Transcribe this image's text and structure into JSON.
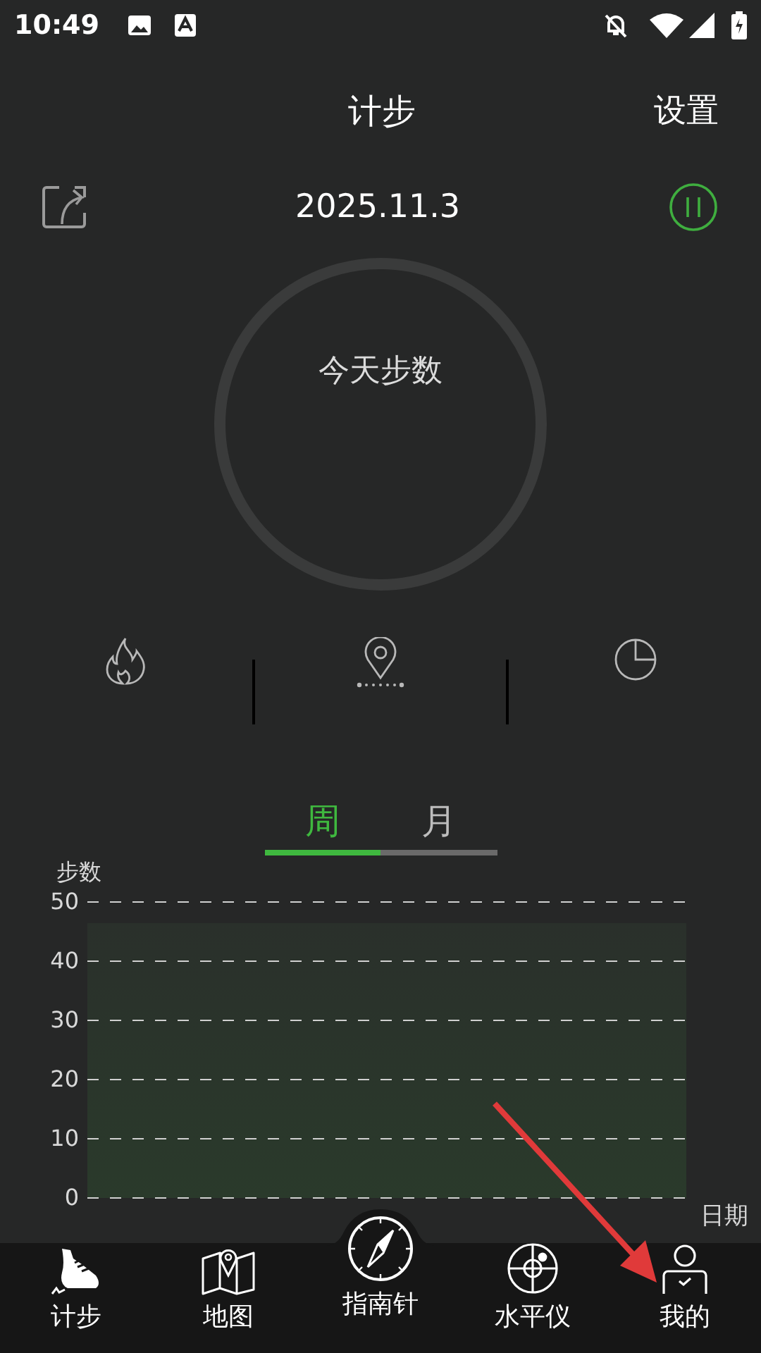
{
  "status_bar": {
    "time": "10:49"
  },
  "header": {
    "title": "计步",
    "action": "设置"
  },
  "date": "2025.11.3",
  "ring": {
    "label": "今天步数"
  },
  "period_tabs": [
    {
      "label": "周",
      "selected": true
    },
    {
      "label": "月",
      "selected": false
    }
  ],
  "chart": {
    "y_axis_title": "步数",
    "y_axis_labels": [
      "50",
      "40",
      "30",
      "20",
      "10",
      "0"
    ],
    "x_axis_title": "日期"
  },
  "bottom_nav": [
    {
      "label": "计步",
      "kind": "shoe"
    },
    {
      "label": "地图",
      "kind": "map"
    },
    {
      "label": "指南针",
      "kind": "compass"
    },
    {
      "label": "水平仪",
      "kind": "level"
    },
    {
      "label": "我的",
      "kind": "person"
    }
  ]
}
